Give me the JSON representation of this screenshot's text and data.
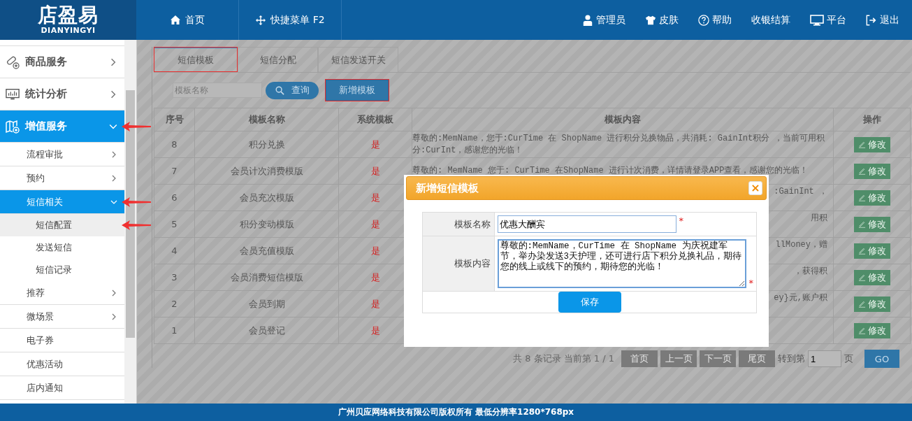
{
  "header": {
    "logo": {
      "title": "店盈易",
      "subtitle": "DIANYINGYI"
    },
    "nav": [
      {
        "label": "首页"
      },
      {
        "label": "快捷菜单 F2"
      }
    ],
    "actions": [
      {
        "label": "管理员"
      },
      {
        "label": "皮肤"
      },
      {
        "label": "帮助"
      },
      {
        "label": "收银结算"
      },
      {
        "label": "平台"
      },
      {
        "label": "退出"
      }
    ]
  },
  "sidebar": {
    "items": [
      {
        "label": "商品服务",
        "selected": false,
        "expanded": false,
        "marked": false
      },
      {
        "label": "统计分析",
        "selected": false,
        "expanded": false,
        "marked": false
      },
      {
        "label": "增值服务",
        "selected": true,
        "expanded": true,
        "marked": true,
        "children": [
          {
            "label": "流程审批",
            "selected": false,
            "expanded": false,
            "marked": false
          },
          {
            "label": "预约",
            "selected": false,
            "expanded": false,
            "marked": false
          },
          {
            "label": "短信相关",
            "selected": true,
            "expanded": true,
            "marked": true,
            "children": [
              {
                "label": "短信配置",
                "selected": true,
                "marked": true
              },
              {
                "label": "发送短信",
                "selected": false,
                "marked": false
              },
              {
                "label": "短信记录",
                "selected": false,
                "marked": false
              }
            ]
          },
          {
            "label": "推荐",
            "selected": false,
            "expanded": false,
            "marked": false
          },
          {
            "label": "微场景",
            "selected": false,
            "expanded": false,
            "marked": false
          },
          {
            "label": "电子券",
            "selected": false,
            "marked": false
          },
          {
            "label": "优惠活动",
            "selected": false,
            "marked": false
          },
          {
            "label": "店内通知",
            "selected": false,
            "marked": false
          }
        ]
      }
    ]
  },
  "tabs": [
    {
      "label": "短信模板",
      "selected": true,
      "highlighted": true
    },
    {
      "label": "短信分配",
      "selected": false,
      "highlighted": false
    },
    {
      "label": "短信发送开关",
      "selected": false,
      "highlighted": false
    }
  ],
  "toolbar": {
    "search": {
      "placeholder": "模板名称"
    },
    "query_button": "查询",
    "add_button": {
      "label": "新增模板",
      "highlighted": true
    }
  },
  "table": {
    "columns": [
      "序号",
      "模板名称",
      "系统模板",
      "模板内容",
      "操作"
    ],
    "rows": [
      {
        "no": "8",
        "name": "积分兑换",
        "system": "是",
        "content": "尊敬的:MemName，您于:CurTime 在 ShopName 进行积分兑换物品，共消耗: GainInt积分 ，当前可用积分:CurInt，感谢您的光临！",
        "action": "修改"
      },
      {
        "no": "7",
        "name": "会员计次消费模版",
        "system": "是",
        "content": "尊敬的: MemName 您于: CurTime 在ShopName 进行计次消费，详情请登录APP查看，感谢您的光临！",
        "action": "修改"
      },
      {
        "no": "6",
        "name": "会员充次模版",
        "system": "是",
        "content_tail": ":GainInt ，",
        "action": "修改"
      },
      {
        "no": "5",
        "name": "积分变动模版",
        "system": "是",
        "content_tail": "用积",
        "action": "修改"
      },
      {
        "no": "4",
        "name": "会员充值模版",
        "system": "是",
        "content_tail": "llMoney，赠",
        "action": "修改"
      },
      {
        "no": "3",
        "name": "会员消费短信模版",
        "system": "是",
        "content_tail": "，获得积",
        "action": "修改"
      },
      {
        "no": "2",
        "name": "会员到期",
        "system": "是",
        "content_tail": "ey}元,账户积",
        "action": "修改"
      },
      {
        "no": "1",
        "name": "会员登记",
        "system": "是",
        "action": "修改"
      }
    ]
  },
  "pagination": {
    "summary": "共 8 条记录 当前第 1 / 1",
    "buttons": [
      "首页",
      "上一页",
      "下一页",
      "尾页"
    ],
    "goto_label": "转到第",
    "page_value": "1",
    "page_unit": "页",
    "go_button": "GO"
  },
  "dialog": {
    "title": "新增短信模板",
    "close": "×",
    "fields": [
      {
        "label": "模板名称",
        "kind": "input",
        "value": "优惠大酬宾",
        "required_mark": "*"
      },
      {
        "label": "模板内容",
        "kind": "textarea",
        "value": "尊敬的:MemName，CurTime 在 ShopName 为庆祝建军节，举办染发送3天护理，还可进行店下积分兑换礼品，期待您的线上或线下的预约，期待您的光临！",
        "required_mark": "*"
      }
    ],
    "save_button": "保存"
  },
  "footer": "广州贝应网络科技有限公司版权所有 最低分辨率1280*768px"
}
